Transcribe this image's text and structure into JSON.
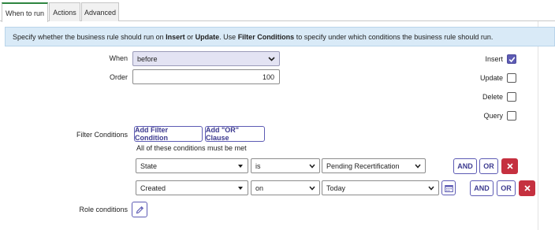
{
  "tabs": [
    {
      "label": "When to run",
      "active": true
    },
    {
      "label": "Actions",
      "active": false
    },
    {
      "label": "Advanced",
      "active": false
    }
  ],
  "info_banner": {
    "pre": "Specify whether the business rule should run on ",
    "insert": "Insert",
    "mid": " or ",
    "update": "Update",
    "mid2": ". Use ",
    "filter": "Filter Conditions",
    "post": " to specify under which conditions the business rule should run."
  },
  "when": {
    "label": "When",
    "value": "before"
  },
  "order": {
    "label": "Order",
    "value": "100"
  },
  "operations": [
    {
      "label": "Insert",
      "checked": true
    },
    {
      "label": "Update",
      "checked": false
    },
    {
      "label": "Delete",
      "checked": false
    },
    {
      "label": "Query",
      "checked": false
    }
  ],
  "filter": {
    "label": "Filter Conditions",
    "add_condition": "Add Filter Condition",
    "add_or": "Add \"OR\" Clause",
    "hint": "All of these conditions must be met",
    "rows": [
      {
        "field": "State",
        "operator": "is",
        "value": "Pending Recertification",
        "and": "AND",
        "or": "OR"
      },
      {
        "field": "Created",
        "operator": "on",
        "value": "Today",
        "and": "AND",
        "or": "OR"
      }
    ]
  },
  "role_conditions": {
    "label": "Role conditions"
  },
  "colors": {
    "accent": "#5d5bb4",
    "tab_active": "#2e8540",
    "delete": "#c5303f",
    "banner": "#d9eaf7"
  },
  "icons": [
    "chevron-down-icon",
    "checkmark-icon",
    "close-icon",
    "calendar-icon",
    "pencil-icon"
  ]
}
